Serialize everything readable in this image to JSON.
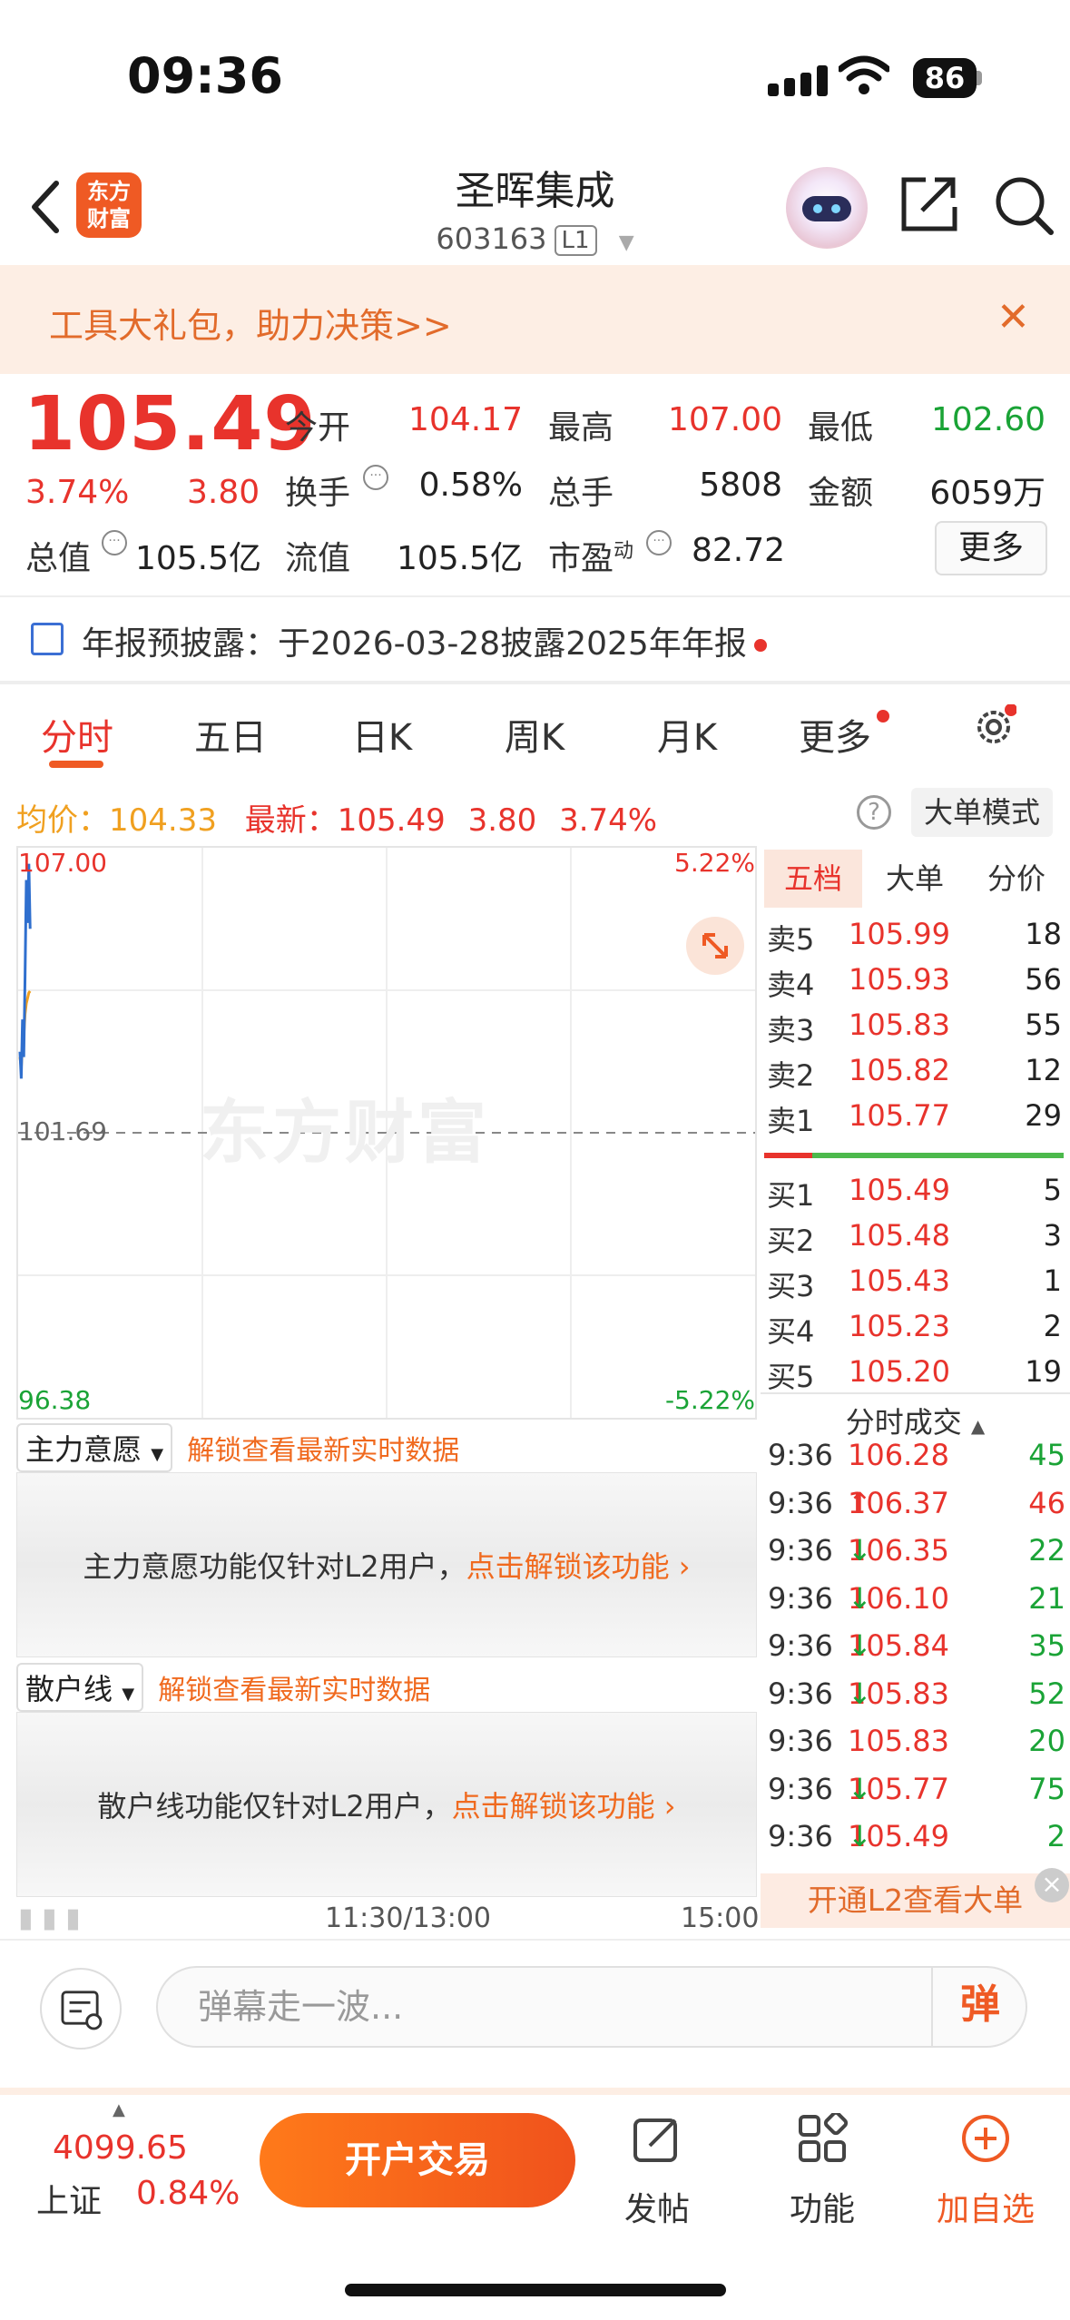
{
  "status_bar": {
    "time": "09:36",
    "battery": "86"
  },
  "header": {
    "logo_text": "东方\n财富",
    "stock_name": "圣晖集成",
    "stock_code": "603163",
    "level_badge": "L1"
  },
  "promo": {
    "text": "工具大礼包，助力决策>>",
    "close": "✕"
  },
  "quote": {
    "price": "105.49",
    "change_pct": "3.74%",
    "change": "3.80",
    "open_label": "今开",
    "open": "104.17",
    "high_label": "最高",
    "high": "107.00",
    "low_label": "最低",
    "low": "102.60",
    "turnover_label": "换手",
    "turnover": "0.58%",
    "volume_label": "总手",
    "volume": "5808",
    "amount_label": "金额",
    "amount": "6059万",
    "mktcap_label": "总值",
    "mktcap": "105.5亿",
    "float_label": "流值",
    "float_cap": "105.5亿",
    "pe_label": "市盈",
    "pe_sup": "动",
    "pe": "82.72",
    "more_button": "更多"
  },
  "notice": {
    "text": "年报预披露：于2026-03-28披露2025年年报"
  },
  "tabs": [
    "分时",
    "五日",
    "日K",
    "周K",
    "月K",
    "更多"
  ],
  "info": {
    "avg_label": "均价：",
    "avg": "104.33",
    "latest_label": "最新：",
    "latest": "105.49",
    "latest_change": "3.80",
    "latest_pct": "3.74%",
    "mode_button": "大单模式"
  },
  "chart_data": {
    "type": "line",
    "title": "",
    "y_top": "107.00",
    "y_mid": "101.69",
    "y_bottom": "96.38",
    "pct_top": "5.22%",
    "pct_bottom": "-5.22%",
    "ylim": [
      96.38,
      107.0
    ],
    "x_labels": [
      "11:30/13:00",
      "15:00"
    ],
    "watermark": "东方财富",
    "series": [
      {
        "values": [
          103.2,
          102.7,
          103.8,
          103.1,
          104.6,
          106.4,
          105.6,
          106.7,
          105.49
        ]
      },
      {
        "values": [
          103.1,
          102.9,
          103.3,
          103.5,
          103.9,
          104.1,
          104.2,
          104.3,
          104.33
        ]
      }
    ]
  },
  "order_book": {
    "tabs": [
      "五档",
      "大单",
      "分价"
    ],
    "asks": [
      {
        "label": "卖5",
        "price": "105.99",
        "vol": "18"
      },
      {
        "label": "卖4",
        "price": "105.93",
        "vol": "56"
      },
      {
        "label": "卖3",
        "price": "105.83",
        "vol": "55"
      },
      {
        "label": "卖2",
        "price": "105.82",
        "vol": "12"
      },
      {
        "label": "卖1",
        "price": "105.77",
        "vol": "29"
      }
    ],
    "bids": [
      {
        "label": "买1",
        "price": "105.49",
        "vol": "5"
      },
      {
        "label": "买2",
        "price": "105.48",
        "vol": "3"
      },
      {
        "label": "买3",
        "price": "105.43",
        "vol": "1"
      },
      {
        "label": "买4",
        "price": "105.23",
        "vol": "2"
      },
      {
        "label": "买5",
        "price": "105.20",
        "vol": "19"
      }
    ]
  },
  "trades": {
    "title": "分时成交",
    "rows": [
      {
        "time": "9:36",
        "price": "106.28",
        "dir": "",
        "vol": "45",
        "vol_color": "green"
      },
      {
        "time": "9:36",
        "price": "106.37",
        "dir": "↑",
        "vol": "46",
        "vol_color": "red"
      },
      {
        "time": "9:36",
        "price": "106.35",
        "dir": "↓",
        "vol": "22",
        "vol_color": "green"
      },
      {
        "time": "9:36",
        "price": "106.10",
        "dir": "↓",
        "vol": "21",
        "vol_color": "green"
      },
      {
        "time": "9:36",
        "price": "105.84",
        "dir": "↓",
        "vol": "35",
        "vol_color": "green"
      },
      {
        "time": "9:36",
        "price": "105.83",
        "dir": "↓",
        "vol": "52",
        "vol_color": "green"
      },
      {
        "time": "9:36",
        "price": "105.83",
        "dir": "",
        "vol": "20",
        "vol_color": "green"
      },
      {
        "time": "9:36",
        "price": "105.77",
        "dir": "↓",
        "vol": "75",
        "vol_color": "green"
      },
      {
        "time": "9:36",
        "price": "105.49",
        "dir": "↓",
        "vol": "2",
        "vol_color": "green"
      }
    ],
    "l2_banner": "开通L2查看大单"
  },
  "panels": {
    "main_force_select": "主力意愿",
    "retail_select": "散户线",
    "unlock_link": "解锁查看最新实时数据",
    "main_force_text": "主力意愿功能仅针对L2用户，",
    "retail_text": "散户线功能仅针对L2用户，",
    "unlock_action": "点击解锁该功能"
  },
  "danmu": {
    "placeholder": "弹幕走一波...",
    "button": "弹"
  },
  "bottom": {
    "index_value": "4099.65",
    "index_name": "上证",
    "index_pct": "0.84%",
    "trade_button": "开户交易",
    "post": "发帖",
    "features": "功能",
    "add_watch": "加自选"
  },
  "colors": {
    "up": "#e8332c",
    "down": "#1aa336",
    "accent": "#ef5a24",
    "price_line": "#2f6fce",
    "avg_line": "#f0a020"
  }
}
